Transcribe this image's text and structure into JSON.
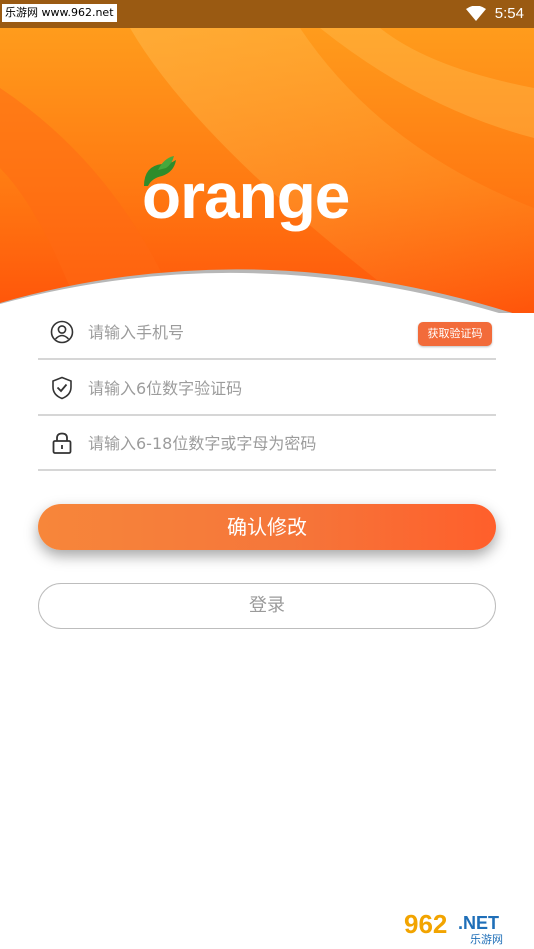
{
  "statusbar": {
    "watermark": "乐游网 www.962.net",
    "time": "5:54"
  },
  "header": {
    "logo_text": "orange",
    "colors": {
      "gradient_top": "#ff9a1a",
      "gradient_bottom": "#ff5a0a"
    }
  },
  "form": {
    "phone": {
      "placeholder": "请输入手机号",
      "icon": "user-icon"
    },
    "get_code_label": "获取验证码",
    "code": {
      "placeholder": "请输入6位数字验证码",
      "icon": "shield-check-icon"
    },
    "password": {
      "placeholder": "请输入6-18位数字或字母为密码",
      "icon": "lock-icon"
    }
  },
  "buttons": {
    "confirm_label": "确认修改",
    "login_label": "登录"
  },
  "footer_watermark": {
    "number": "962",
    "net": ".NET",
    "cn": "乐游网"
  }
}
